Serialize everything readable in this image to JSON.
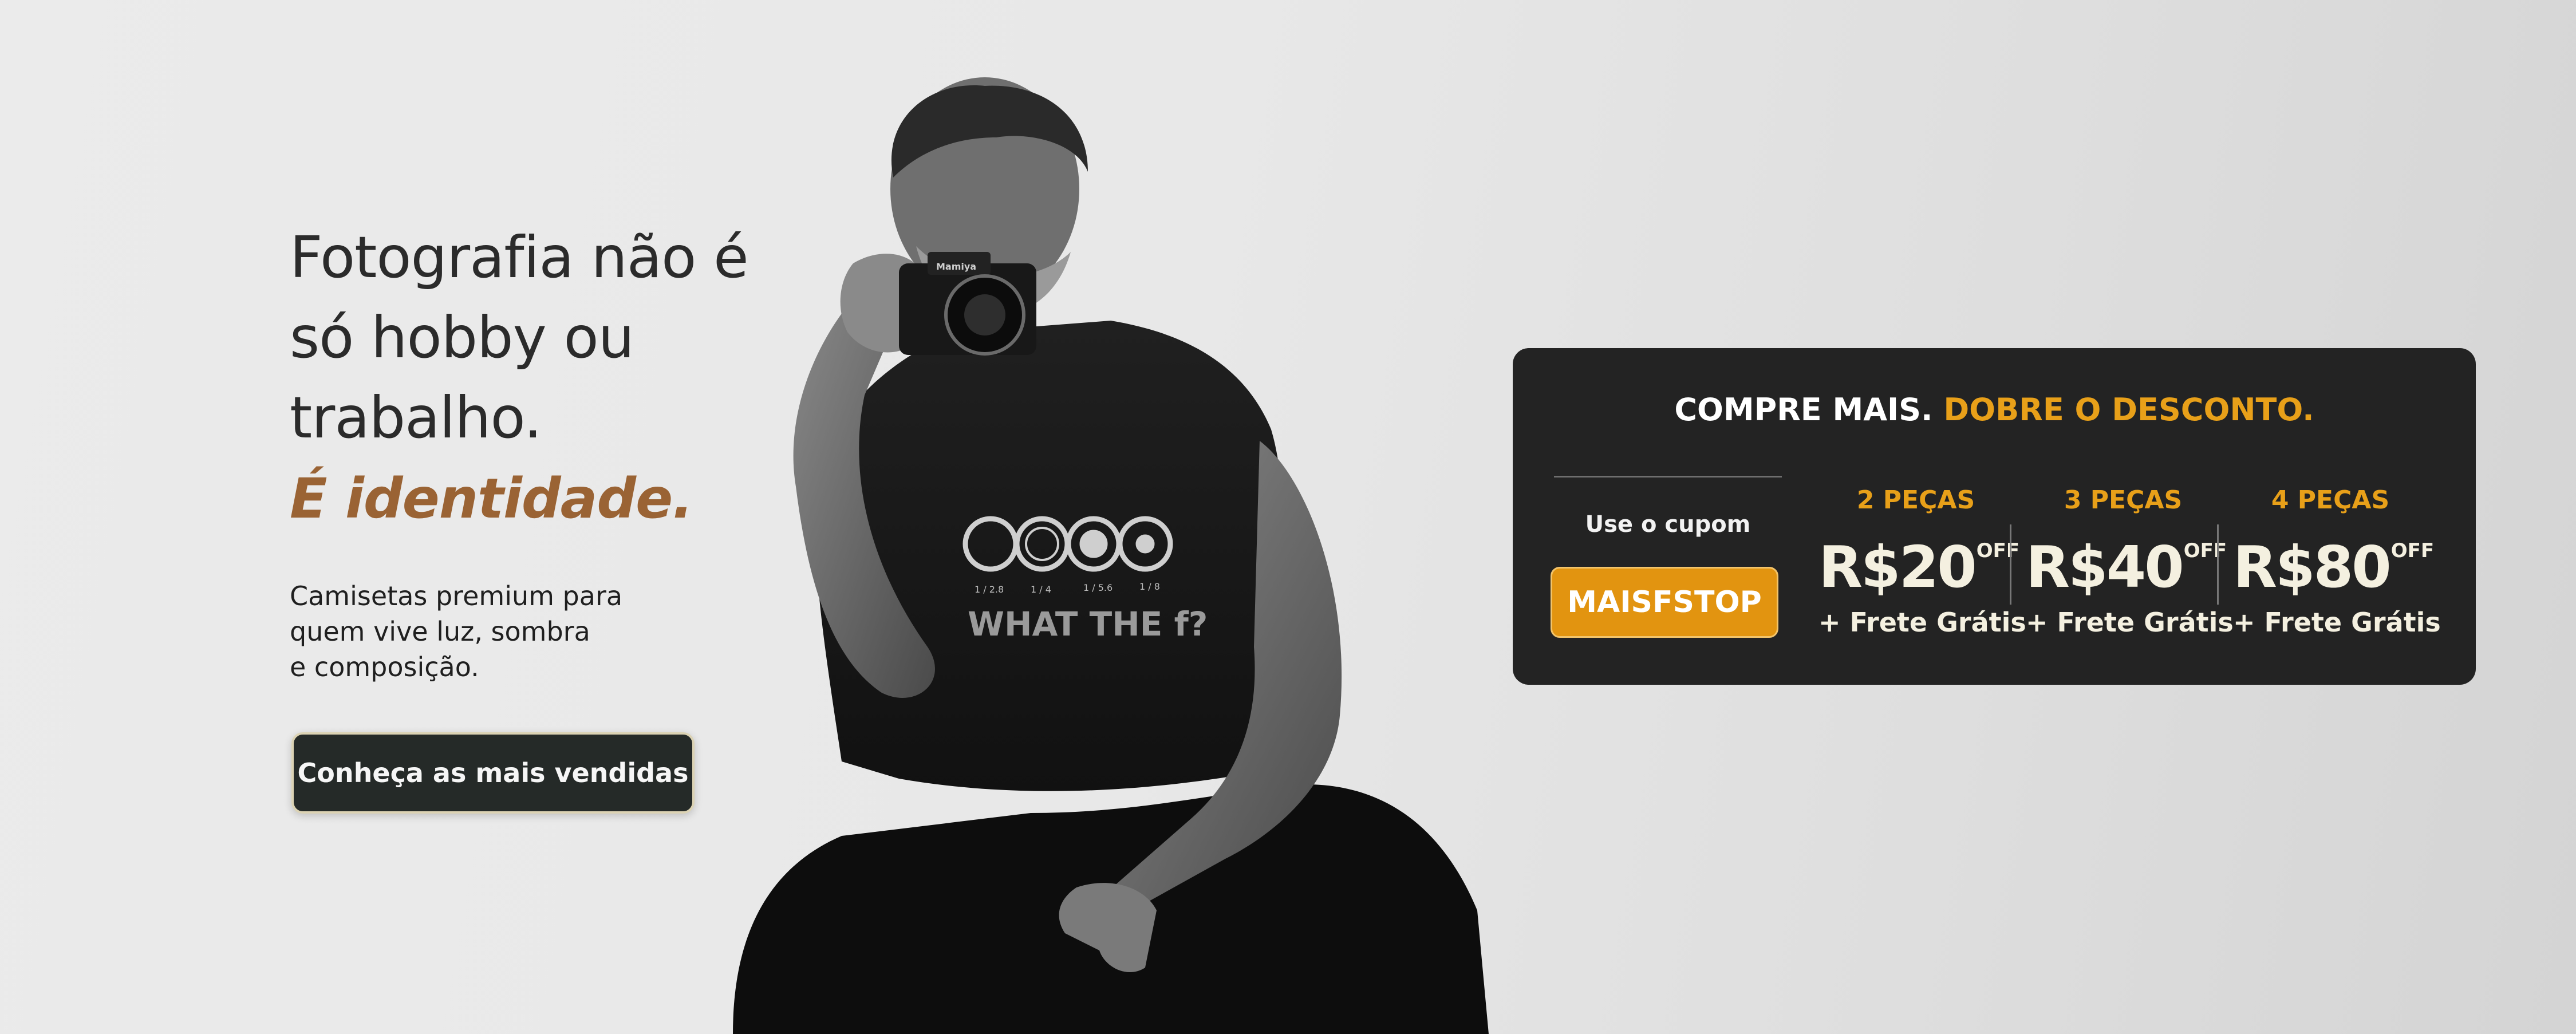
{
  "hero": {
    "headline_lines": [
      "Fotografia não é",
      "só hobby ou",
      "trabalho."
    ],
    "highlight": "É identidade.",
    "subtext_lines": [
      "Camisetas premium para",
      "quem vive luz, sombra",
      "e composição."
    ],
    "cta_label": "Conheça as mais vendidas"
  },
  "photo": {
    "camera_brand": "Mamiya",
    "shirt_text": "WHAT THE f?",
    "shirt_apertures": [
      "1 / 2.8",
      "1 / 4",
      "1 / 5.6",
      "1 / 8"
    ]
  },
  "promo": {
    "title_main": "COMPRE MAIS.",
    "title_accent": "DOBRE O DESCONTO.",
    "coupon_label": "Use o cupom",
    "coupon_code": "MAISFSTOP",
    "tiers": [
      {
        "qty": "2 PEÇAS",
        "price": "R$20",
        "off": "OFF",
        "bonus": "+ Frete Grátis"
      },
      {
        "qty": "3 PEÇAS",
        "price": "R$40",
        "off": "OFF",
        "bonus": "+ Frete Grátis"
      },
      {
        "qty": "4 PEÇAS",
        "price": "R$80",
        "off": "OFF",
        "bonus": "+ Frete Grátis"
      }
    ]
  },
  "colors": {
    "accent_orange": "#e8a019",
    "highlight_brown": "#9a6334",
    "card_dark": "#232323",
    "button_dark": "#252a28"
  }
}
